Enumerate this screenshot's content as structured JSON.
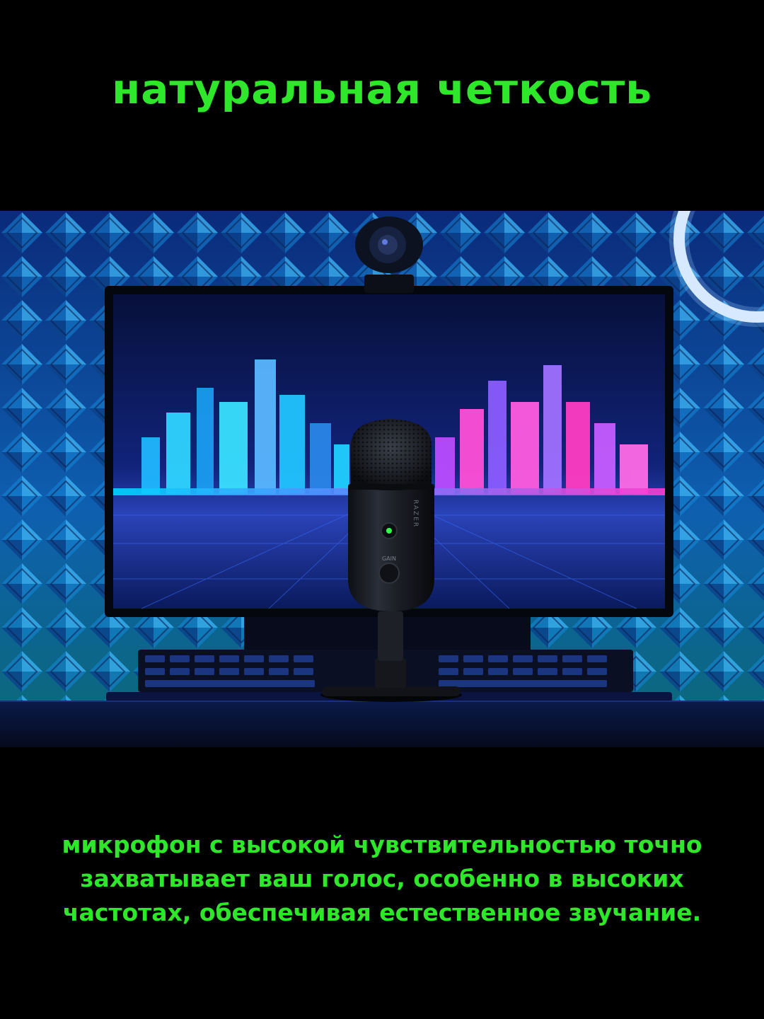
{
  "headline": "натуральная четкость",
  "caption": {
    "lines": [
      "микрофон с высокой чувствительностью точно",
      "захватывает ваш голос, особенно в высоких",
      "частотах, обеспечивая естественное звучание."
    ]
  },
  "product_labels": {
    "brand": "RAZER",
    "gain": "GAIN"
  },
  "colors": {
    "accent_green": "#2ee62a",
    "background": "#000000"
  }
}
